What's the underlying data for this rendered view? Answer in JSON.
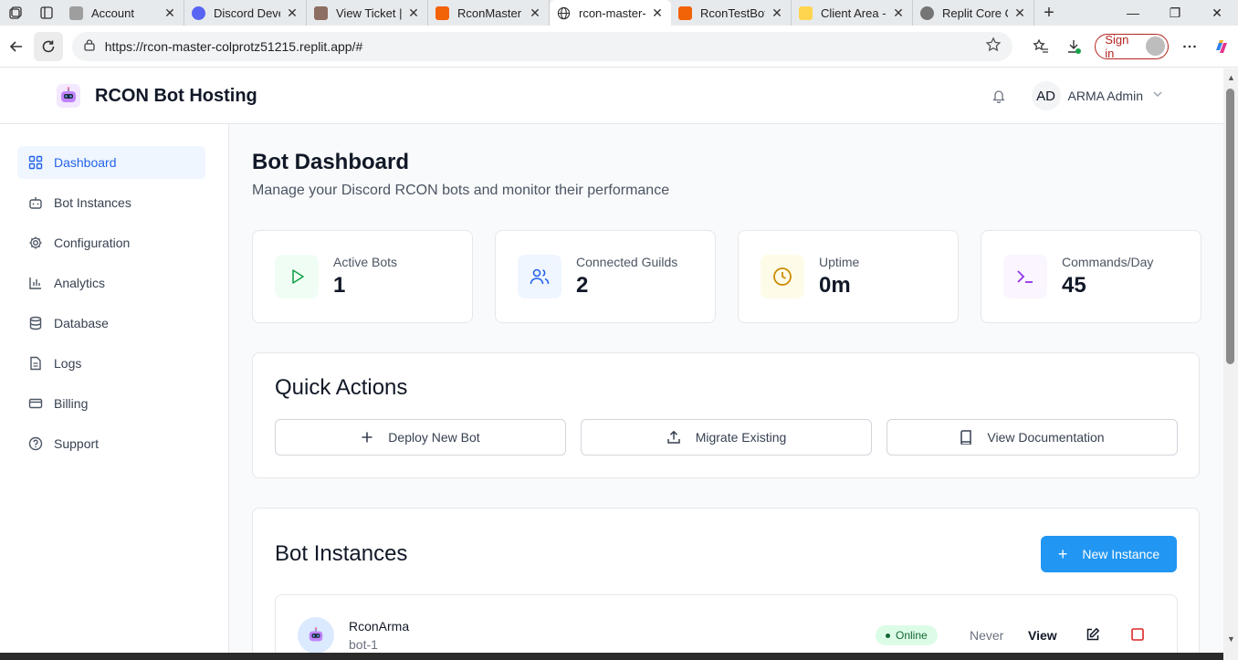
{
  "browser": {
    "tabs": [
      {
        "title": "Account",
        "favicon_color": "#9e9e9e",
        "active": false
      },
      {
        "title": "Discord Deve",
        "favicon_color": "#5865f2",
        "active": false
      },
      {
        "title": "View Ticket | C",
        "favicon_color": "#8d6e63",
        "active": false
      },
      {
        "title": "RconMaster -",
        "favicon_color": "#f26207",
        "active": false
      },
      {
        "title": "rcon-master-c",
        "favicon_color": "#ffffff",
        "active": true
      },
      {
        "title": "RconTestBot -",
        "favicon_color": "#f26207",
        "active": false
      },
      {
        "title": "Client Area -",
        "favicon_color": "#ffd54f",
        "active": false
      },
      {
        "title": "Replit Core O",
        "favicon_color": "#757575",
        "active": false
      }
    ],
    "url": "https://rcon-master-colprotz51215.replit.app/#",
    "sign_in_label": "Sign in"
  },
  "header": {
    "brand": "RCON Bot Hosting",
    "user_initials": "AD",
    "user_name": "ARMA Admin"
  },
  "sidebar": {
    "items": [
      {
        "label": "Dashboard",
        "icon": "grid-icon",
        "active": true
      },
      {
        "label": "Bot Instances",
        "icon": "bot-icon",
        "active": false
      },
      {
        "label": "Configuration",
        "icon": "gear-icon",
        "active": false
      },
      {
        "label": "Analytics",
        "icon": "bar-chart-icon",
        "active": false
      },
      {
        "label": "Database",
        "icon": "database-icon",
        "active": false
      },
      {
        "label": "Logs",
        "icon": "file-icon",
        "active": false
      },
      {
        "label": "Billing",
        "icon": "credit-card-icon",
        "active": false
      },
      {
        "label": "Support",
        "icon": "help-circle-icon",
        "active": false
      }
    ]
  },
  "main": {
    "title": "Bot Dashboard",
    "subtitle": "Manage your Discord RCON bots and monitor their performance",
    "stats": [
      {
        "label": "Active Bots",
        "value": "1",
        "icon": "play-icon",
        "bg": "#f0fdf4",
        "color": "#16a34a"
      },
      {
        "label": "Connected Guilds",
        "value": "2",
        "icon": "users-icon",
        "bg": "#eff6ff",
        "color": "#2563eb"
      },
      {
        "label": "Uptime",
        "value": "0m",
        "icon": "clock-icon",
        "bg": "#fefce8",
        "color": "#ca8a04"
      },
      {
        "label": "Commands/Day",
        "value": "45",
        "icon": "terminal-icon",
        "bg": "#faf5ff",
        "color": "#9333ea"
      }
    ],
    "quick_actions": {
      "title": "Quick Actions",
      "buttons": [
        {
          "label": "Deploy New Bot",
          "icon": "plus-icon"
        },
        {
          "label": "Migrate Existing",
          "icon": "upload-icon"
        },
        {
          "label": "View Documentation",
          "icon": "book-icon"
        }
      ]
    },
    "bot_instances": {
      "title": "Bot Instances",
      "new_button": "New Instance",
      "rows": [
        {
          "name": "RconArma",
          "id": "bot-1",
          "status": "Online",
          "last_seen": "Never",
          "view_label": "View"
        }
      ]
    }
  }
}
